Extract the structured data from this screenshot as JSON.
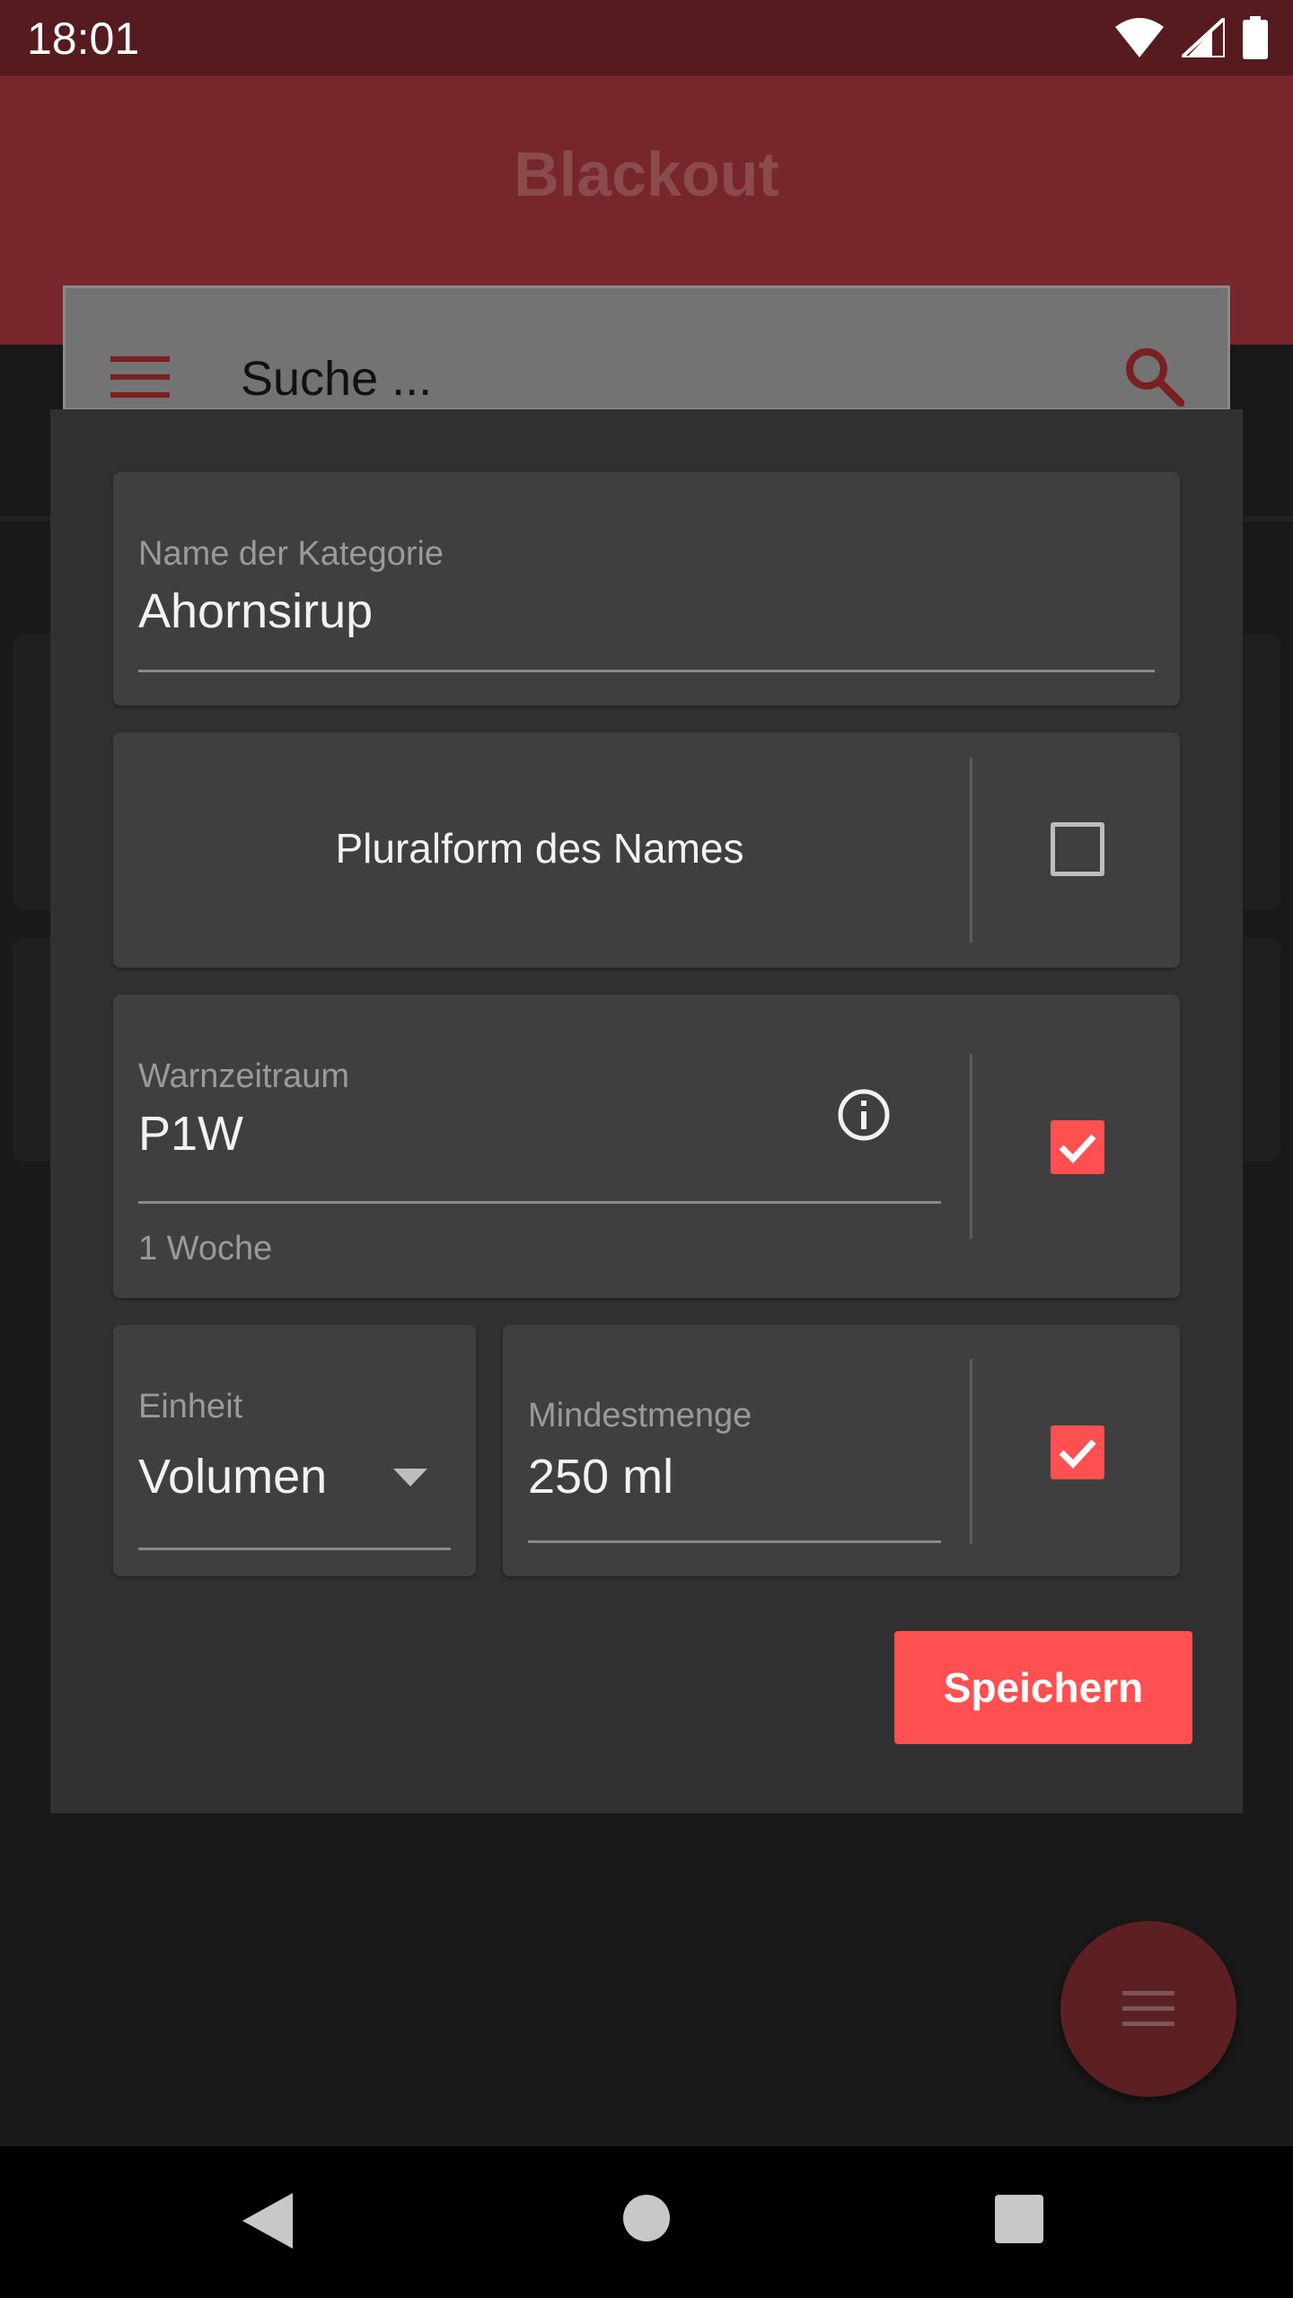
{
  "status_bar": {
    "time": "18:01"
  },
  "app_bar": {
    "title": "Blackout"
  },
  "search": {
    "placeholder": "Suche ..."
  },
  "dialog": {
    "name_field": {
      "label": "Name der Kategorie",
      "value": "Ahornsirup"
    },
    "plural": {
      "label": "Pluralform des Names",
      "checked": false
    },
    "warning_period": {
      "label": "Warnzeitraum",
      "value": "P1W",
      "hint": "1 Woche",
      "checked": true
    },
    "unit": {
      "label": "Einheit",
      "value": "Volumen"
    },
    "min_amount": {
      "label": "Mindestmenge",
      "value": "250 ml",
      "checked": true
    },
    "save_label": "Speichern"
  },
  "colors": {
    "accent": "#fe5050",
    "primary": "#77272b",
    "status_bar": "#561b1e",
    "dialog_bg": "#313131",
    "field_bg": "#3f3f3f"
  },
  "icons": [
    "wifi-icon",
    "signal-icon",
    "battery-icon",
    "menu-icon",
    "search-icon",
    "info-icon",
    "dropdown-arrow-icon",
    "check-icon",
    "back-icon",
    "home-icon",
    "recents-icon"
  ]
}
